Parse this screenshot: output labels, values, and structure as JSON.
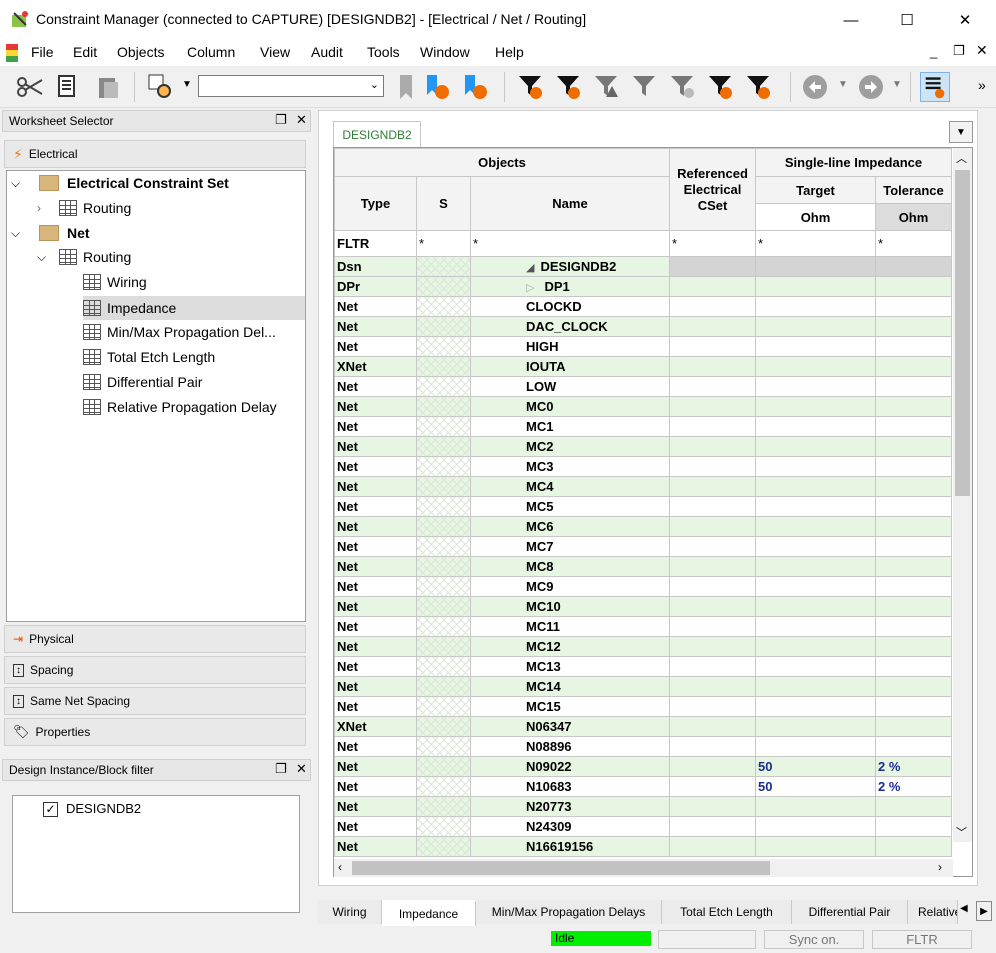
{
  "window": {
    "title": "Constraint Manager (connected to CAPTURE) [DESIGNDB2] - [Electrical / Net / Routing]",
    "minimize": "—",
    "maximize": "☐",
    "close": "✕"
  },
  "menu": [
    "File",
    "Edit",
    "Objects",
    "Column",
    "View",
    "Audit",
    "Tools",
    "Window",
    "Help"
  ],
  "toolbar": {
    "combo_value": ""
  },
  "worksheet_selector": {
    "title": "Worksheet Selector",
    "electrical_tab": "Electrical",
    "tree": {
      "ecs": "Electrical Constraint Set",
      "ecs_routing": "Routing",
      "net": "Net",
      "net_routing": "Routing",
      "items": [
        "Wiring",
        "Impedance",
        "Min/Max Propagation Del...",
        "Total Etch Length",
        "Differential Pair",
        "Relative Propagation Delay"
      ]
    },
    "tabs": [
      "Physical",
      "Spacing",
      "Same Net Spacing",
      "Properties"
    ]
  },
  "design_filter": {
    "title": "Design Instance/Block filter",
    "item": "DESIGNDB2"
  },
  "grid": {
    "doc_tab": "DESIGNDB2",
    "headers": {
      "objects": "Objects",
      "type": "Type",
      "s": "S",
      "name": "Name",
      "ref_cset": "Referenced Electrical CSet",
      "sli": "Single-line Impedance",
      "target": "Target",
      "tolerance": "Tolerance",
      "unit_target": "Ohm",
      "unit_tol": "Ohm"
    },
    "filter": {
      "type": "FLTR",
      "s": "*",
      "name": "*",
      "ref": "*",
      "target": "*",
      "tol": "*"
    },
    "rows": [
      {
        "type": "Dsn",
        "name": "DESIGNDB2",
        "target": "",
        "tol": ""
      },
      {
        "type": "DPr",
        "name": "DP1",
        "target": "",
        "tol": ""
      },
      {
        "type": "Net",
        "name": "CLOCKD",
        "target": "",
        "tol": ""
      },
      {
        "type": "Net",
        "name": "DAC_CLOCK",
        "target": "",
        "tol": ""
      },
      {
        "type": "Net",
        "name": "HIGH",
        "target": "",
        "tol": ""
      },
      {
        "type": "XNet",
        "name": "IOUTA",
        "target": "",
        "tol": ""
      },
      {
        "type": "Net",
        "name": "LOW",
        "target": "",
        "tol": ""
      },
      {
        "type": "Net",
        "name": "MC0",
        "target": "",
        "tol": ""
      },
      {
        "type": "Net",
        "name": "MC1",
        "target": "",
        "tol": ""
      },
      {
        "type": "Net",
        "name": "MC2",
        "target": "",
        "tol": ""
      },
      {
        "type": "Net",
        "name": "MC3",
        "target": "",
        "tol": ""
      },
      {
        "type": "Net",
        "name": "MC4",
        "target": "",
        "tol": ""
      },
      {
        "type": "Net",
        "name": "MC5",
        "target": "",
        "tol": ""
      },
      {
        "type": "Net",
        "name": "MC6",
        "target": "",
        "tol": ""
      },
      {
        "type": "Net",
        "name": "MC7",
        "target": "",
        "tol": ""
      },
      {
        "type": "Net",
        "name": "MC8",
        "target": "",
        "tol": ""
      },
      {
        "type": "Net",
        "name": "MC9",
        "target": "",
        "tol": ""
      },
      {
        "type": "Net",
        "name": "MC10",
        "target": "",
        "tol": ""
      },
      {
        "type": "Net",
        "name": "MC11",
        "target": "",
        "tol": ""
      },
      {
        "type": "Net",
        "name": "MC12",
        "target": "",
        "tol": ""
      },
      {
        "type": "Net",
        "name": "MC13",
        "target": "",
        "tol": ""
      },
      {
        "type": "Net",
        "name": "MC14",
        "target": "",
        "tol": ""
      },
      {
        "type": "Net",
        "name": "MC15",
        "target": "",
        "tol": ""
      },
      {
        "type": "XNet",
        "name": "N06347",
        "target": "",
        "tol": ""
      },
      {
        "type": "Net",
        "name": "N08896",
        "target": "",
        "tol": ""
      },
      {
        "type": "Net",
        "name": "N09022",
        "target": "50",
        "tol": "2 %"
      },
      {
        "type": "Net",
        "name": "N10683",
        "target": "50",
        "tol": "2 %"
      },
      {
        "type": "Net",
        "name": "N20773",
        "target": "",
        "tol": ""
      },
      {
        "type": "Net",
        "name": "N24309",
        "target": "",
        "tol": ""
      },
      {
        "type": "Net",
        "name": "N16619156",
        "target": "",
        "tol": ""
      }
    ]
  },
  "bottom_tabs": [
    "Wiring",
    "Impedance",
    "Min/Max Propagation Delays",
    "Total Etch Length",
    "Differential Pair",
    "Relative"
  ],
  "status": {
    "idle": "Idle",
    "sync": "Sync on.",
    "fltr": "FLTR"
  },
  "colors": {
    "row_green": "#e7f6e2",
    "idle_green": "#00ee00",
    "value_blue": "#1b2d8f"
  }
}
